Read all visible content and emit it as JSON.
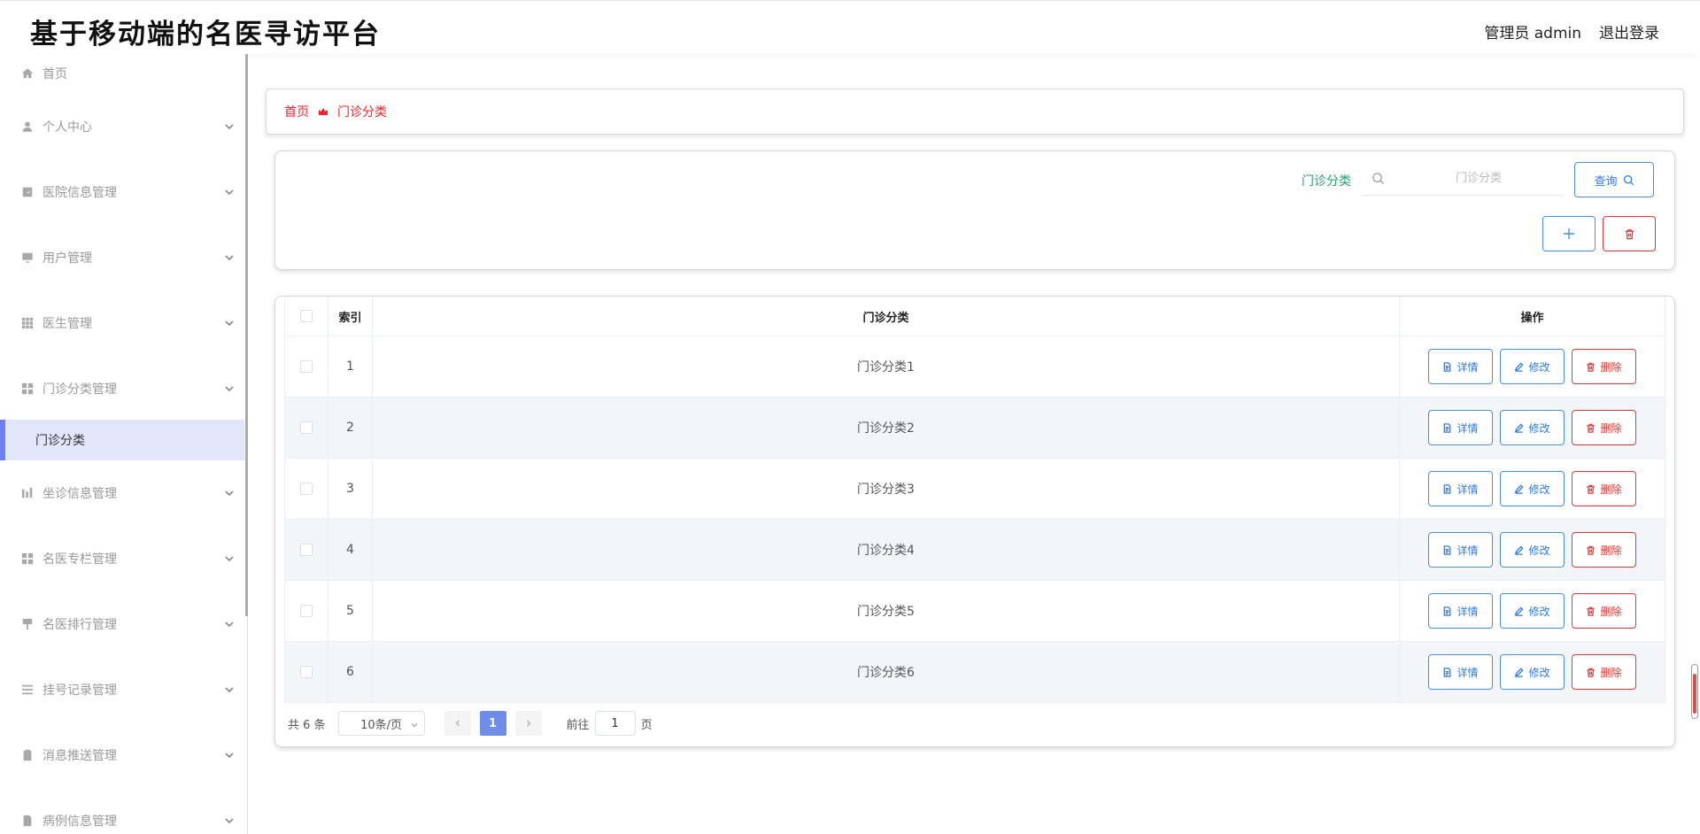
{
  "header": {
    "title": "基于移动端的名医寻访平台",
    "user": "管理员 admin",
    "logout": "退出登录"
  },
  "sidebar": {
    "items": [
      {
        "label": "首页",
        "icon": "home-icon",
        "expandable": false
      },
      {
        "label": "个人中心",
        "icon": "user-icon",
        "expandable": true
      },
      {
        "label": "医院信息管理",
        "icon": "chart-icon",
        "expandable": true
      },
      {
        "label": "用户管理",
        "icon": "monitor-icon",
        "expandable": true
      },
      {
        "label": "医生管理",
        "icon": "grid-icon",
        "expandable": true
      },
      {
        "label": "门诊分类管理",
        "icon": "apps-icon",
        "expandable": true
      },
      {
        "label": "坐诊信息管理",
        "icon": "bar-chart-icon",
        "expandable": true
      },
      {
        "label": "名医专栏管理",
        "icon": "apps-icon",
        "expandable": true
      },
      {
        "label": "名医排行管理",
        "icon": "brush-icon",
        "expandable": true
      },
      {
        "label": "挂号记录管理",
        "icon": "list-icon",
        "expandable": true
      },
      {
        "label": "消息推送管理",
        "icon": "clipboard-icon",
        "expandable": true
      },
      {
        "label": "病例信息管理",
        "icon": "file-icon",
        "expandable": true
      }
    ],
    "active_sub": "门诊分类"
  },
  "breadcrumb": {
    "home": "首页",
    "current": "门诊分类"
  },
  "search": {
    "label": "门诊分类",
    "placeholder": "门诊分类",
    "query_label": "查询"
  },
  "table": {
    "headers": {
      "index": "索引",
      "name": "门诊分类",
      "ops": "操作"
    },
    "rows": [
      {
        "index": "1",
        "name": "门诊分类1"
      },
      {
        "index": "2",
        "name": "门诊分类2"
      },
      {
        "index": "3",
        "name": "门诊分类3"
      },
      {
        "index": "4",
        "name": "门诊分类4"
      },
      {
        "index": "5",
        "name": "门诊分类5"
      },
      {
        "index": "6",
        "name": "门诊分类6"
      }
    ],
    "actions": {
      "detail": "详情",
      "edit": "修改",
      "delete": "删除"
    }
  },
  "pager": {
    "total": "共 6 条",
    "page_size": "10条/页",
    "current_page": "1",
    "goto_prefix": "前往",
    "goto_value": "1",
    "goto_suffix": "页"
  },
  "colors": {
    "accent": "#6f7ef0",
    "primary": "#2f7be5",
    "danger": "#e53935",
    "label_green": "#22a06b"
  }
}
